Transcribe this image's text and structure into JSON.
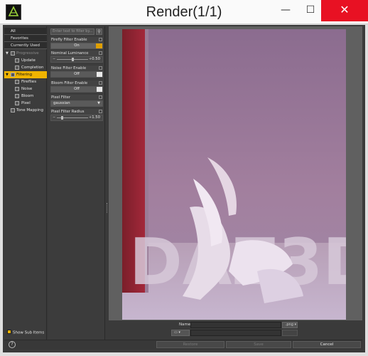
{
  "window": {
    "title": "Render(1/1)",
    "minimize_glyph": "—",
    "maximize_glyph": "☐",
    "close_glyph": "✕",
    "logo_caption": "DAZ 3D"
  },
  "nav": {
    "top_items": [
      "All",
      "Favorites",
      "Currently Used"
    ],
    "items": [
      {
        "label": "Progressive",
        "level": 0,
        "state": "dim"
      },
      {
        "label": "Update",
        "level": 1,
        "state": "normal"
      },
      {
        "label": "Completion",
        "level": 1,
        "state": "normal"
      },
      {
        "label": "Filtering",
        "level": 0,
        "state": "selected"
      },
      {
        "label": "Fireflies",
        "level": 1,
        "state": "normal"
      },
      {
        "label": "Noise",
        "level": 1,
        "state": "normal"
      },
      {
        "label": "Bloom",
        "level": 1,
        "state": "normal"
      },
      {
        "label": "Pixel",
        "level": 1,
        "state": "normal"
      },
      {
        "label": "Tone Mapping",
        "level": 0,
        "state": "normal"
      }
    ],
    "show_sub_items": "Show Sub Items"
  },
  "props": {
    "filter_placeholder": "Enter text to filter by...",
    "firefly_label": "Firefly Filter Enable",
    "firefly_value": "On",
    "luminance_label": "Nominal Luminance",
    "luminance_value": "0.50",
    "luminance_fraction": 0.5,
    "noise_label": "Noise Filter Enable",
    "noise_value": "Off",
    "bloom_label": "Bloom Filter Enable",
    "bloom_value": "Off",
    "pixel_filter_label": "Pixel Filter",
    "pixel_filter_value": "gaussian",
    "pixel_radius_label": "Pixel Filter Radius",
    "pixel_radius_value": "1.50",
    "pixel_radius_fraction": 0.15
  },
  "render": {
    "watermark_text": "DAZ3D"
  },
  "savebar": {
    "name_label": "Name :",
    "ext_value": ".png",
    "folder_icon": "folder-icon"
  },
  "footer": {
    "help": "?",
    "restore": "Restore",
    "save": "Save",
    "cancel": "Cancel"
  },
  "colors": {
    "accent": "#f0b400",
    "close": "#e81123"
  }
}
